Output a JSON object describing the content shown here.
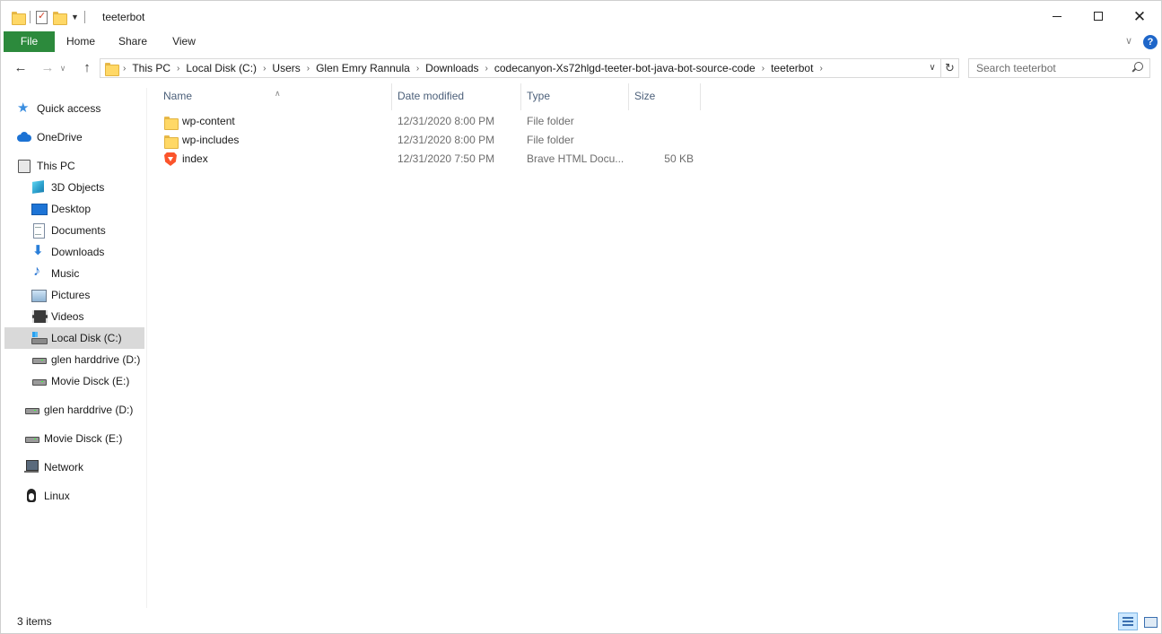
{
  "window": {
    "title": "teeterbot"
  },
  "ribbon": {
    "tabs": [
      {
        "label": "File"
      },
      {
        "label": "Home"
      },
      {
        "label": "Share"
      },
      {
        "label": "View"
      }
    ]
  },
  "address_bar": {
    "crumbs": [
      "This PC",
      "Local Disk (C:)",
      "Users",
      "Glen Emry Rannula",
      "Downloads",
      "codecanyon-Xs72hlgd-teeter-bot-java-bot-source-code",
      "teeterbot"
    ]
  },
  "search": {
    "placeholder": "Search teeterbot"
  },
  "sidebar": {
    "items": [
      {
        "label": "Quick access",
        "icon": "star-icon"
      },
      {
        "label": "OneDrive",
        "icon": "cloud-icon"
      },
      {
        "label": "This PC",
        "icon": "computer-icon"
      },
      {
        "label": "3D Objects",
        "icon": "cube-icon"
      },
      {
        "label": "Desktop",
        "icon": "desktop-icon"
      },
      {
        "label": "Documents",
        "icon": "document-icon"
      },
      {
        "label": "Downloads",
        "icon": "download-icon"
      },
      {
        "label": "Music",
        "icon": "music-icon"
      },
      {
        "label": "Pictures",
        "icon": "pictures-icon"
      },
      {
        "label": "Videos",
        "icon": "video-icon"
      },
      {
        "label": "Local Disk (C:)",
        "icon": "local-disk-icon",
        "selected": true
      },
      {
        "label": "glen harddrive (D:)",
        "icon": "drive-icon"
      },
      {
        "label": "Movie Disck (E:)",
        "icon": "drive-icon"
      },
      {
        "label": "glen harddrive (D:)",
        "icon": "drive-icon"
      },
      {
        "label": "Movie Disck (E:)",
        "icon": "drive-icon"
      },
      {
        "label": "Network",
        "icon": "network-icon"
      },
      {
        "label": "Linux",
        "icon": "linux-icon"
      }
    ]
  },
  "file_list": {
    "columns": {
      "name": "Name",
      "date": "Date modified",
      "type": "Type",
      "size": "Size"
    },
    "rows": [
      {
        "name": "wp-content",
        "date": "12/31/2020 8:00 PM",
        "type": "File folder",
        "size": "",
        "icon": "folder-icon"
      },
      {
        "name": "wp-includes",
        "date": "12/31/2020 8:00 PM",
        "type": "File folder",
        "size": "",
        "icon": "folder-icon"
      },
      {
        "name": "index",
        "date": "12/31/2020 7:50 PM",
        "type": "Brave HTML Docu...",
        "size": "50 KB",
        "icon": "brave-html-icon"
      }
    ]
  },
  "status": {
    "item_count": "3 items"
  },
  "colors": {
    "file_tab": "#2c8a3c",
    "selection": "#d9d9d9",
    "header_text": "#4c607a",
    "accent": "#1e66c9"
  }
}
